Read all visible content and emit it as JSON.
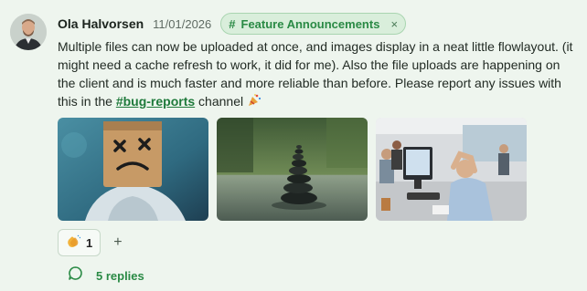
{
  "message": {
    "author": "Ola Halvorsen",
    "date": "11/01/2026",
    "channel_tag": "Feature Announcements",
    "channel_tag_close": "×",
    "text_before_link": "Multiple files can now be uploaded at once, and images display in a neat little flowlayout. (it might need a cache refresh to work, it did for me). Also the file uploads are happening on the client and is much faster and more reliable than before. Please report any issues with this in the ",
    "channel_link": "#bug-reports",
    "text_after_link": " channel",
    "trailing_emoji": "party-popper-icon"
  },
  "reactions": [
    {
      "emoji": "clapping-hands-icon",
      "count": "1"
    }
  ],
  "add_reaction_label": "+",
  "replies": {
    "label": "5 replies"
  },
  "colors": {
    "background": "#eef5ee",
    "accent_green": "#2a8a45",
    "pill_bg": "#d9eedb"
  }
}
